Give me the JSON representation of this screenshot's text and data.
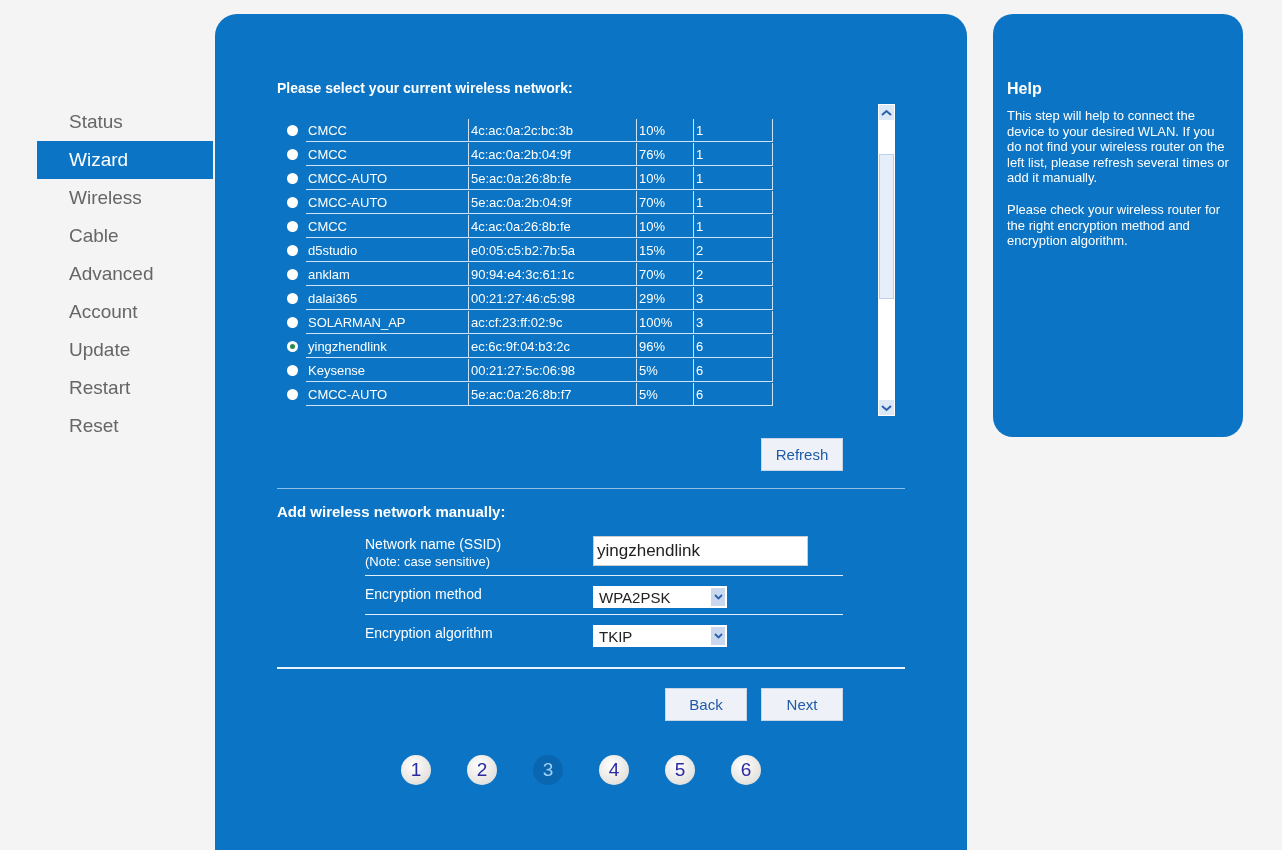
{
  "sidebar": {
    "items": [
      {
        "label": "Status",
        "selected": false
      },
      {
        "label": "Wizard",
        "selected": true
      },
      {
        "label": "Wireless",
        "selected": false
      },
      {
        "label": "Cable",
        "selected": false
      },
      {
        "label": "Advanced",
        "selected": false
      },
      {
        "label": "Account",
        "selected": false
      },
      {
        "label": "Update",
        "selected": false
      },
      {
        "label": "Restart",
        "selected": false
      },
      {
        "label": "Reset",
        "selected": false
      }
    ]
  },
  "network_list": {
    "title": "Please select your current wireless network:",
    "rows": [
      {
        "ssid": "CMCC",
        "mac": "4c:ac:0a:2c:bc:3b",
        "signal": "10%",
        "channel": "1",
        "selected": false
      },
      {
        "ssid": "CMCC",
        "mac": "4c:ac:0a:2b:04:9f",
        "signal": "76%",
        "channel": "1",
        "selected": false
      },
      {
        "ssid": "CMCC-AUTO",
        "mac": "5e:ac:0a:26:8b:fe",
        "signal": "10%",
        "channel": "1",
        "selected": false
      },
      {
        "ssid": "CMCC-AUTO",
        "mac": "5e:ac:0a:2b:04:9f",
        "signal": "70%",
        "channel": "1",
        "selected": false
      },
      {
        "ssid": "CMCC",
        "mac": "4c:ac:0a:26:8b:fe",
        "signal": "10%",
        "channel": "1",
        "selected": false
      },
      {
        "ssid": "d5studio",
        "mac": "e0:05:c5:b2:7b:5a",
        "signal": "15%",
        "channel": "2",
        "selected": false
      },
      {
        "ssid": "anklam",
        "mac": "90:94:e4:3c:61:1c",
        "signal": "70%",
        "channel": "2",
        "selected": false
      },
      {
        "ssid": "dalai365",
        "mac": "00:21:27:46:c5:98",
        "signal": "29%",
        "channel": "3",
        "selected": false
      },
      {
        "ssid": "SOLARMAN_AP",
        "mac": "ac:cf:23:ff:02:9c",
        "signal": "100%",
        "channel": "3",
        "selected": false
      },
      {
        "ssid": "yingzhendlink",
        "mac": "ec:6c:9f:04:b3:2c",
        "signal": "96%",
        "channel": "6",
        "selected": true
      },
      {
        "ssid": "Keysense",
        "mac": "00:21:27:5c:06:98",
        "signal": "5%",
        "channel": "6",
        "selected": false
      },
      {
        "ssid": "CMCC-AUTO",
        "mac": "5e:ac:0a:26:8b:f7",
        "signal": "5%",
        "channel": "6",
        "selected": false
      }
    ],
    "refresh_button": "Refresh"
  },
  "manual": {
    "title": "Add wireless network manually:",
    "fields": [
      {
        "kind": "text",
        "label": "Network name (SSID)",
        "note": "(Note: case sensitive)",
        "value": "yingzhendlink"
      },
      {
        "kind": "select",
        "label": "Encryption method",
        "value": "WPA2PSK"
      },
      {
        "kind": "select",
        "label": "Encryption algorithm",
        "value": "TKIP"
      }
    ]
  },
  "buttons": [
    "Back",
    "Next"
  ],
  "steps": [
    {
      "label": "1",
      "selected": false
    },
    {
      "label": "2",
      "selected": false
    },
    {
      "label": "3",
      "selected": true
    },
    {
      "label": "4",
      "selected": false
    },
    {
      "label": "5",
      "selected": false
    },
    {
      "label": "6",
      "selected": false
    }
  ],
  "help": {
    "title": "Help",
    "paragraphs": [
      "This step will help to connect the device to your desired WLAN. If you do not find your wireless router on the left list, please refresh several times or add it manually.",
      "Please check your wireless router for the right encryption method and encryption algorithm."
    ]
  }
}
